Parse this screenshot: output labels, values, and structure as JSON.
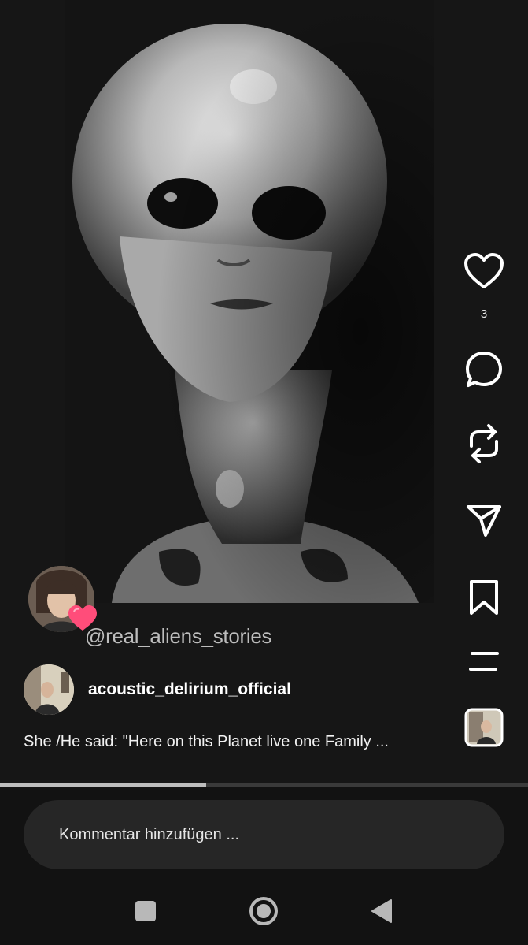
{
  "post": {
    "watermark": "@real_aliens_stories",
    "author": "acoustic_delirium_official",
    "caption": "She /He said: \"Here on this Planet live one Family ...",
    "progress": 0.39
  },
  "actions": {
    "like_count": "3",
    "icons": [
      "heart-icon",
      "comment-icon",
      "repost-icon",
      "send-icon",
      "bookmark-icon",
      "menu-icon",
      "audio-thumbnail"
    ]
  },
  "comment": {
    "placeholder": "Kommentar hinzufügen ..."
  },
  "colors": {
    "background": "#121212",
    "input_background": "#262626",
    "heart_badge": "#ff4d7a",
    "progress_fill": "#bdbdbd"
  },
  "system_nav": {
    "icons": [
      "recents-square-icon",
      "home-circle-icon",
      "back-triangle-icon"
    ]
  }
}
